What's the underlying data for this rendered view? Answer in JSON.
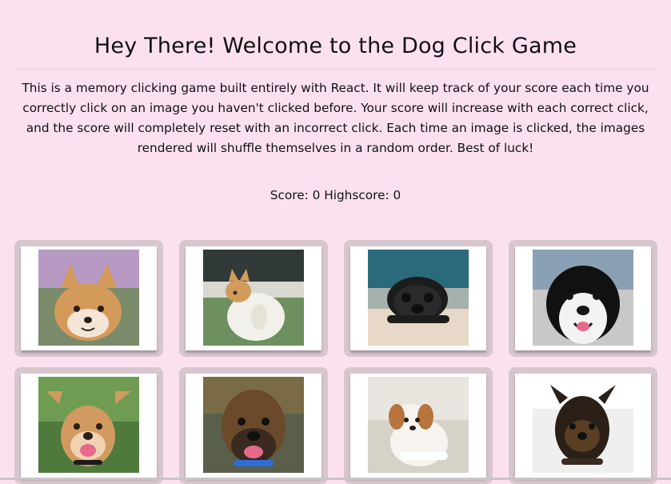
{
  "header": {
    "title": "Hey There! Welcome to the Dog Click Game",
    "intro": "This is a memory clicking game built entirely with React. It will keep track of your score each time you correctly click on an image you haven't clicked before. Your score will increase with each correct click, and the score will completely reset with an incorrect click. Each time an image is clicked, the images rendered will shuffle themselves in a random order. Best of luck!"
  },
  "score": {
    "text": "Score: 0 Highscore: 0"
  },
  "cards": [
    {
      "name": "shiba-inu",
      "colors": {
        "bg": "#7a8a6a",
        "top": "#b79ac4",
        "body": "#d39a5a",
        "face": "#f4e6d6",
        "nose": "#2b1d17"
      }
    },
    {
      "name": "corgi",
      "colors": {
        "bg": "#6e8f5f",
        "top": "#2f3a39",
        "body": "#f2f0ea",
        "face": "#d19b5a",
        "nose": "#3b2b1f"
      }
    },
    {
      "name": "pug",
      "colors": {
        "bg": "#a7b1ab",
        "top": "#2a6a7a",
        "body": "#1c1c1c",
        "face": "#2a2a2a",
        "nose": "#0f0f0f"
      }
    },
    {
      "name": "border-collie",
      "colors": {
        "bg": "#c8c8c8",
        "top": "#8aa0b4",
        "body": "#111111",
        "face": "#f3f3f3",
        "nose": "#151515"
      }
    },
    {
      "name": "mixed-dog",
      "colors": {
        "bg": "#4f7a3c",
        "top": "#6f9c52",
        "body": "#d29a60",
        "face": "#f0d2b3",
        "nose": "#2a1d17"
      }
    },
    {
      "name": "boxer",
      "colors": {
        "bg": "#5a5f4b",
        "top": "#7a6b47",
        "body": "#6b4a2c",
        "face": "#3a2a20",
        "nose": "#111111"
      }
    },
    {
      "name": "puppy",
      "colors": {
        "bg": "#d7d2c8",
        "top": "#e9e6df",
        "body": "#f7f4ef",
        "face": "#b7743d",
        "nose": "#2a1d17"
      }
    },
    {
      "name": "brussels-griffon",
      "colors": {
        "bg": "#efefef",
        "top": "#ffffff",
        "body": "#2a2018",
        "face": "#5a3f25",
        "nose": "#111111"
      }
    }
  ]
}
